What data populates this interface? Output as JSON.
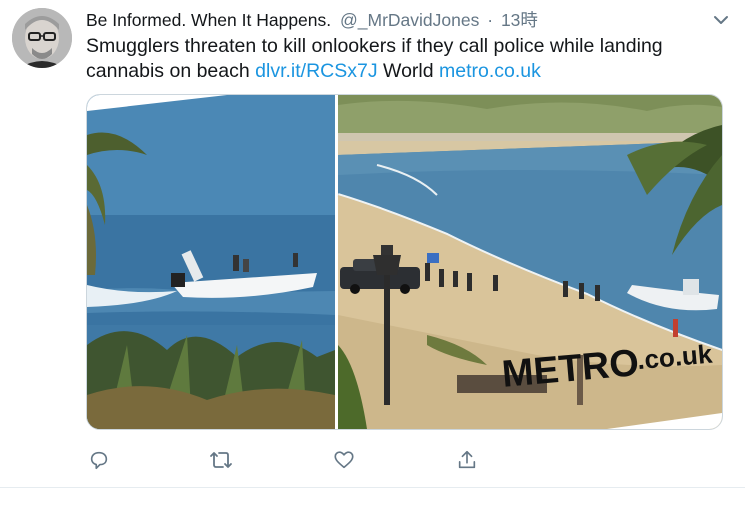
{
  "tweet": {
    "display_name": "Be Informed. When It Happens.",
    "handle": "@_MrDavidJones",
    "separator": "·",
    "time": "13時",
    "text_main": "Smugglers threaten to kill onlookers if they call police while landing cannabis on beach",
    "link_short": "dlvr.it/RCSx7J",
    "category": "World",
    "link_domain": "metro.co.uk"
  },
  "media": {
    "watermark_brand": "METRO",
    "watermark_suffix": ".co.uk"
  },
  "icons": {
    "menu": "chevron-down-icon",
    "reply": "reply-icon",
    "retweet": "retweet-icon",
    "like": "like-icon",
    "share": "share-icon"
  },
  "colors": {
    "link": "#1b95e0",
    "secondary_text": "#657786",
    "action_icon": "#657786"
  }
}
